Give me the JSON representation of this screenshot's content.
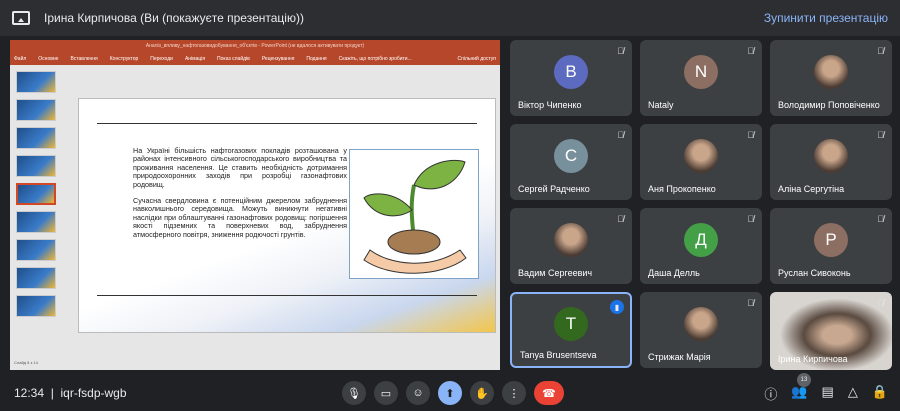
{
  "header": {
    "title": "Ірина Кирпичова (Ви (покажуєте презентацію))",
    "stop_label": "Зупинити презентацію"
  },
  "powerpoint": {
    "title": "Аналіз_впливу_нафтогазовидобування_об'єктів - PowerPoint (не вдалося активувати продукт)",
    "menu": [
      "Файл",
      "Основне",
      "Вставлення",
      "Конструктор",
      "Переходи",
      "Анімація",
      "Показ слайдів",
      "Рецензування",
      "Подання",
      "Скажіть, що потрібно зробити...",
      "Спільний доступ"
    ],
    "slide_count": 9,
    "selected_slide": 5,
    "status": "Слайд 5 з 14",
    "paragraphs": [
      "На Україні більшість нафтогазових покладів розташована у районах інтенсивного сільськогосподарського виробництва та проживання населення. Це ставить необхідність дотримання природоохоронних заходів при розробці газонафтових родовищ.",
      "Сучасна свердловина є потенційним джерелом забруднення навколишнього середовища. Можуть виникнути негативні наслідки при облаштуванні газонафтових родовищ: погіршення якості підземних та поверхневих вод, забруднення атмосферного повітря, зниження родючості грунтів."
    ]
  },
  "participants": [
    {
      "name": "Віктор Чипенко",
      "initial": "В",
      "color": "#5c6bc0"
    },
    {
      "name": "Nataly",
      "initial": "N",
      "color": "#8d6e63"
    },
    {
      "name": "Володимир Поповіченко",
      "initial": "",
      "color": ""
    },
    {
      "name": "Сергей Радченко",
      "initial": "С",
      "color": "#78909c"
    },
    {
      "name": "Аня Прокопенко",
      "initial": "",
      "color": ""
    },
    {
      "name": "Аліна Сергутіна",
      "initial": "",
      "color": ""
    },
    {
      "name": "Вадим Сергеевич",
      "initial": "",
      "color": ""
    },
    {
      "name": "Даша Делль",
      "initial": "Д",
      "color": "#43a047"
    },
    {
      "name": "Руслан Сивоконь",
      "initial": "Р",
      "color": "#8d6e63"
    },
    {
      "name": "Tanya Brusentseva",
      "initial": "T",
      "color": "#33691e"
    },
    {
      "name": "Стрижак Марія",
      "initial": "",
      "color": ""
    },
    {
      "name": "Ірина Кирпичова",
      "initial": "",
      "color": ""
    }
  ],
  "footer": {
    "time": "12:34",
    "meeting_code": "iqr-fsdp-wgb",
    "participant_count": "13"
  }
}
